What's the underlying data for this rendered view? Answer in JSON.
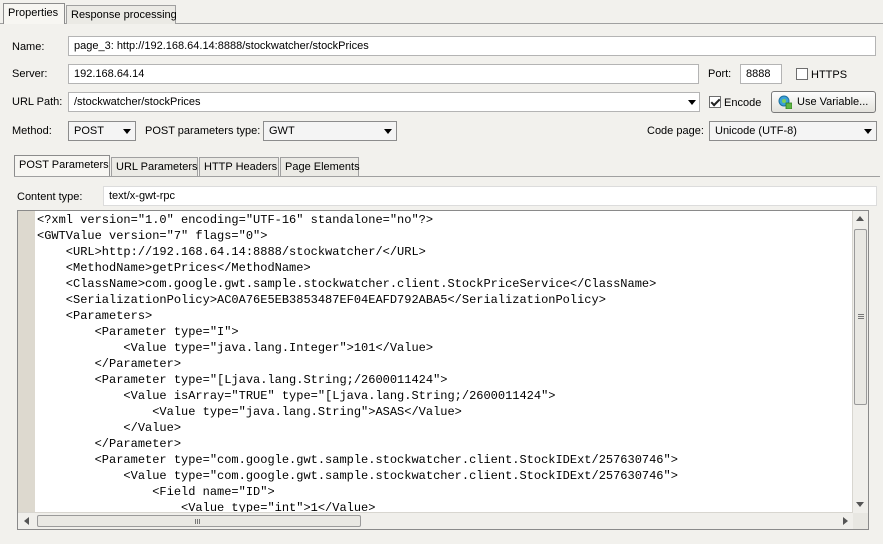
{
  "top_tabs": [
    "Properties",
    "Response processing"
  ],
  "form": {
    "name_label": "Name:",
    "name_value": "page_3: http://192.168.64.14:8888/stockwatcher/stockPrices",
    "server_label": "Server:",
    "server_value": "192.168.64.14",
    "port_label": "Port:",
    "port_value": "8888",
    "https_label": "HTTPS",
    "https_checked": false,
    "urlpath_label": "URL Path:",
    "urlpath_value": "/stockwatcher/stockPrices",
    "encode_label": "Encode",
    "encode_checked": true,
    "use_variable_label": "Use Variable...",
    "method_label": "Method:",
    "method_value": "POST",
    "post_type_label": "POST parameters type:",
    "post_type_value": "GWT",
    "codepage_label": "Code page:",
    "codepage_value": "Unicode (UTF-8)"
  },
  "sub_tabs": [
    "POST Parameters",
    "URL Parameters",
    "HTTP Headers",
    "Page Elements"
  ],
  "content": {
    "type_label": "Content type:",
    "type_value": "text/x-gwt-rpc"
  },
  "editor_lines": [
    "<?xml version=\"1.0\" encoding=\"UTF-16\" standalone=\"no\"?>",
    "<GWTValue version=\"7\" flags=\"0\">",
    "    <URL>http://192.168.64.14:8888/stockwatcher/</URL>",
    "    <MethodName>getPrices</MethodName>",
    "    <ClassName>com.google.gwt.sample.stockwatcher.client.StockPriceService</ClassName>",
    "    <SerializationPolicy>AC0A76E5EB3853487EF04EAFD792ABA5</SerializationPolicy>",
    "    <Parameters>",
    "        <Parameter type=\"I\">",
    "            <Value type=\"java.lang.Integer\">101</Value>",
    "        </Parameter>",
    "        <Parameter type=\"[Ljava.lang.String;/2600011424\">",
    "            <Value isArray=\"TRUE\" type=\"[Ljava.lang.String;/2600011424\">",
    "                <Value type=\"java.lang.String\">ASAS</Value>",
    "            </Value>",
    "        </Parameter>",
    "        <Parameter type=\"com.google.gwt.sample.stockwatcher.client.StockIDExt/257630746\">",
    "            <Value type=\"com.google.gwt.sample.stockwatcher.client.StockIDExt/257630746\">",
    "                <Field name=\"ID\">",
    "                    <Value type=\"int\">1</Value>"
  ],
  "icons": [
    "variable-icon",
    "chevron-down-icon",
    "scroll-up-arrow-icon",
    "scroll-down-arrow-icon",
    "scroll-left-arrow-icon",
    "scroll-right-arrow-icon"
  ]
}
